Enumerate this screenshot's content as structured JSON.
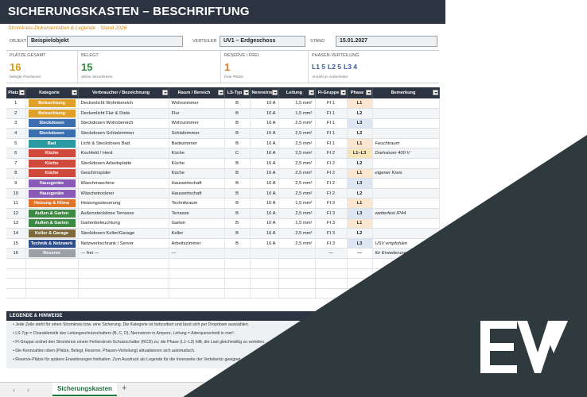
{
  "header": {
    "title": "SICHERUNGSKASTEN – BESCHRIFTUNG",
    "subtitle": "Stromkreis-Dokumentation & Legende · Stand 2026"
  },
  "meta": {
    "objekt_label": "OBJEKT",
    "objekt_value": "Beispielobjekt",
    "verteiler_label": "VERTEILER",
    "verteiler_value": "UV1 – Erdgeschoss",
    "stand_label": "STAND",
    "stand_value": "15.01.2027"
  },
  "kpis": {
    "plaetze": {
      "label": "PLÄTZE GESAMT",
      "value": "16",
      "sub": "belegte Positionen",
      "color": "#d69a10"
    },
    "belegt": {
      "label": "BELEGT",
      "value": "15",
      "sub": "aktive Stromkreise",
      "color": "#2e8b3a"
    },
    "reserve": {
      "label": "RESERVE / FREI",
      "value": "1",
      "sub": "freie Plätze",
      "color": "#e07b1a"
    },
    "phasen": {
      "label": "PHASEN-VERTEILUNG",
      "l1": "L1 5",
      "l2": "L2 5",
      "l3": "L3 4",
      "sub": "Anzahl je Außenleiter"
    }
  },
  "columns": [
    "Platz",
    "Kategorie",
    "Verbraucher / Bezeichnung",
    "Raum / Bereich",
    "LS-Typ",
    "Nennstrom",
    "Leitung",
    "FI-Gruppe",
    "Phase",
    "Bemerkung"
  ],
  "rows": [
    {
      "nr": "1",
      "cat": "Beleuchtung",
      "catColor": "#e0a12a",
      "verb": "Deckenlicht Wohnbereich",
      "raum": "Wohnzimmer",
      "ls": "B",
      "nenn": "10 A",
      "lei": "1,5 mm²",
      "fi": "FI 1",
      "phase": "L1",
      "phaseColor": "#fbe6cf",
      "bem": ""
    },
    {
      "nr": "2",
      "cat": "Beleuchtung",
      "catColor": "#e0a12a",
      "verb": "Deckenlicht Flur & Diele",
      "raum": "Flur",
      "ls": "B",
      "nenn": "10 A",
      "lei": "1,5 mm²",
      "fi": "FI 1",
      "phase": "L2",
      "phaseColor": "#f3f4f6",
      "bem": ""
    },
    {
      "nr": "3",
      "cat": "Steckdosen",
      "catColor": "#3c6fb0",
      "verb": "Steckdosen Wohnbereich",
      "raum": "Wohnzimmer",
      "ls": "B",
      "nenn": "16 A",
      "lei": "2,5 mm²",
      "fi": "FI 1",
      "phase": "L3",
      "phaseColor": "#dde6f3",
      "bem": ""
    },
    {
      "nr": "4",
      "cat": "Steckdosen",
      "catColor": "#3c6fb0",
      "verb": "Steckdosen Schlafzimmer",
      "raum": "Schlafzimmer",
      "ls": "B",
      "nenn": "16 A",
      "lei": "2,5 mm²",
      "fi": "FI 1",
      "phase": "L2",
      "phaseColor": "#f3f4f6",
      "bem": ""
    },
    {
      "nr": "5",
      "cat": "Bad",
      "catColor": "#2a9aa0",
      "verb": "Licht & Steckdosen Bad",
      "raum": "Badezimmer",
      "ls": "B",
      "nenn": "16 A",
      "lei": "2,5 mm²",
      "fi": "FI 1",
      "phase": "L1",
      "phaseColor": "#fbe6cf",
      "bem": "Feuchtraum"
    },
    {
      "nr": "6",
      "cat": "Küche",
      "catColor": "#cf4a3c",
      "verb": "Kochfeld / Herd",
      "raum": "Küche",
      "ls": "C",
      "nenn": "16 A",
      "lei": "2,5 mm²",
      "fi": "FI 2",
      "phase": "L1–L3",
      "phaseColor": "#f7e5b8",
      "bem": "Drehstrom 400 V"
    },
    {
      "nr": "7",
      "cat": "Küche",
      "catColor": "#cf4a3c",
      "verb": "Steckdosen Arbeitsplatte",
      "raum": "Küche",
      "ls": "B",
      "nenn": "16 A",
      "lei": "2,5 mm²",
      "fi": "FI 2",
      "phase": "L2",
      "phaseColor": "#f3f4f6",
      "bem": ""
    },
    {
      "nr": "8",
      "cat": "Küche",
      "catColor": "#cf4a3c",
      "verb": "Geschirrspüler",
      "raum": "Küche",
      "ls": "B",
      "nenn": "16 A",
      "lei": "2,5 mm²",
      "fi": "FI 2",
      "phase": "L1",
      "phaseColor": "#fbe6cf",
      "bem": "eigener Kreis"
    },
    {
      "nr": "9",
      "cat": "Hausgeräte",
      "catColor": "#8a5ab8",
      "verb": "Waschmaschine",
      "raum": "Hauswirtschaft",
      "ls": "B",
      "nenn": "16 A",
      "lei": "2,5 mm²",
      "fi": "FI 2",
      "phase": "L3",
      "phaseColor": "#dde6f3",
      "bem": ""
    },
    {
      "nr": "10",
      "cat": "Hausgeräte",
      "catColor": "#8a5ab8",
      "verb": "Wäschetrockner",
      "raum": "Hauswirtschaft",
      "ls": "B",
      "nenn": "16 A",
      "lei": "2,5 mm²",
      "fi": "FI 2",
      "phase": "L2",
      "phaseColor": "#f3f4f6",
      "bem": ""
    },
    {
      "nr": "11",
      "cat": "Heizung & Klima",
      "catColor": "#e0752a",
      "verb": "Heizungssteuerung",
      "raum": "Technikraum",
      "ls": "B",
      "nenn": "10 A",
      "lei": "1,5 mm²",
      "fi": "FI 3",
      "phase": "L1",
      "phaseColor": "#fbe6cf",
      "bem": ""
    },
    {
      "nr": "12",
      "cat": "Außen & Garten",
      "catColor": "#3e8a45",
      "verb": "Außensteckdose Terrasse",
      "raum": "Terrasse",
      "ls": "B",
      "nenn": "16 A",
      "lei": "2,5 mm²",
      "fi": "FI 3",
      "phase": "L3",
      "phaseColor": "#dde6f3",
      "bem": "wetterfest IP44"
    },
    {
      "nr": "13",
      "cat": "Außen & Garten",
      "catColor": "#3e8a45",
      "verb": "Gartenbeleuchtung",
      "raum": "Garten",
      "ls": "B",
      "nenn": "10 A",
      "lei": "1,5 mm²",
      "fi": "FI 3",
      "phase": "L1",
      "phaseColor": "#fbe6cf",
      "bem": ""
    },
    {
      "nr": "14",
      "cat": "Keller & Garage",
      "catColor": "#7d6a3f",
      "verb": "Steckdosen Keller/Garage",
      "raum": "Keller",
      "ls": "B",
      "nenn": "16 A",
      "lei": "2,5 mm²",
      "fi": "FI 3",
      "phase": "L2",
      "phaseColor": "#f3f4f6",
      "bem": ""
    },
    {
      "nr": "15",
      "cat": "Technik & Netzwerk",
      "catColor": "#2f4f8a",
      "verb": "Netzwerkschrank / Server",
      "raum": "Arbeitszimmer",
      "ls": "B",
      "nenn": "16 A",
      "lei": "2,5 mm²",
      "fi": "FI 3",
      "phase": "L3",
      "phaseColor": "#dde6f3",
      "bem": "USV empfohlen"
    },
    {
      "nr": "16",
      "cat": "Reserve",
      "catColor": "#9aa0a6",
      "verb": "— frei —",
      "raum": "—",
      "ls": "",
      "nenn": "",
      "lei": "",
      "fi": "—",
      "phase": "—",
      "phaseColor": "#ffffff",
      "bem": "für Erweiterung"
    }
  ],
  "legend": {
    "title": "LEGENDE & HINWEISE",
    "items": [
      "• Jede Zeile steht für einen Stromkreis bzw. eine Sicherung. Die Kategorie ist farbcodiert und lässt sich per Dropdown auswählen.",
      "• LS-Typ = Charakteristik des Leitungsschutzschalters (B, C, D), Nennstrom in Ampere, Leitung = Aderquerschnitt in mm².",
      "• FI-Gruppe ordnet den Stromkreis einem Fehlerstrom-Schutzschalter (RCD) zu; die Phase (L1–L3) hilft, die Last gleichmäßig zu verteilen.",
      "• Die Kennzahlen oben (Plätze, Belegt, Reserve, Phasen-Verteilung) aktualisieren sich automatisch.",
      "• Reserve-Plätze für spätere Erweiterungen freihalten. Zum Ausdruck als Legende für die Innenseite der Verteilertür geeignet."
    ]
  },
  "tabs": {
    "active": "Sicherungskasten",
    "prev": "‹",
    "next": "›",
    "add": "+"
  },
  "colors": {
    "header": "#2b3440",
    "overlay": "#2f3a3e",
    "accent": "#d28a12"
  }
}
